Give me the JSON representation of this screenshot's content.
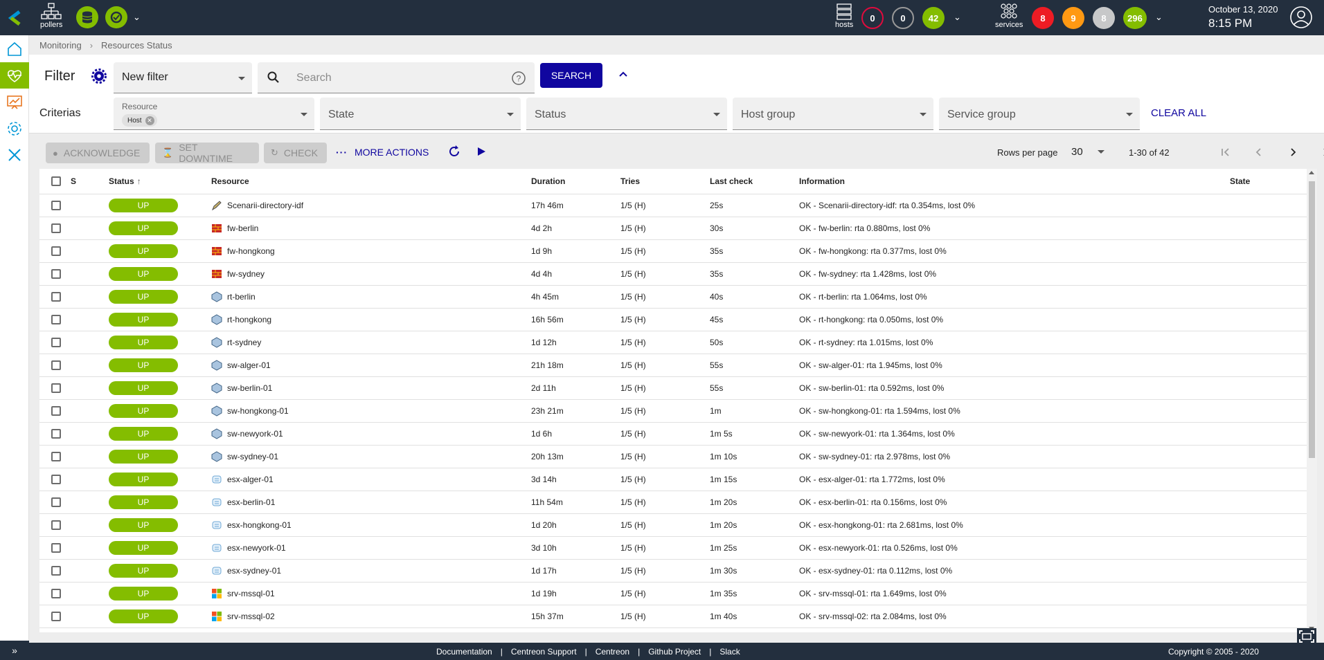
{
  "topbar": {
    "pollers_label": "pollers",
    "hosts_label": "hosts",
    "services_label": "services",
    "host_counts": {
      "down": "0",
      "unreachable": "0",
      "up": "42"
    },
    "service_counts": {
      "critical": "8",
      "warning": "9",
      "unknown": "8",
      "ok": "296"
    },
    "date": "October 13, 2020",
    "time": "8:15 PM"
  },
  "breadcrumb": {
    "parent": "Monitoring",
    "current": "Resources Status"
  },
  "filter": {
    "title": "Filter",
    "selected_filter": "New filter",
    "search_placeholder": "Search",
    "search_button": "SEARCH",
    "criterias_label": "Criterias",
    "resource_label": "Resource",
    "resource_chip": "Host",
    "state_label": "State",
    "status_label": "Status",
    "host_group_label": "Host group",
    "service_group_label": "Service group",
    "clear_all": "CLEAR ALL"
  },
  "actions": {
    "acknowledge": "ACKNOWLEDGE",
    "set_downtime": "SET DOWNTIME",
    "check": "CHECK",
    "more_actions": "MORE ACTIONS",
    "rows_per_page_label": "Rows per page",
    "rows_per_page_value": "30",
    "page_range": "1-30 of 42"
  },
  "table": {
    "columns": {
      "s": "S",
      "status": "Status",
      "resource": "Resource",
      "duration": "Duration",
      "tries": "Tries",
      "last_check": "Last check",
      "information": "Information",
      "state": "State"
    },
    "rows": [
      {
        "status": "UP",
        "icon": "pencil-icon",
        "resource": "Scenarii-directory-idf",
        "duration": "17h 46m",
        "tries": "1/5 (H)",
        "last_check": "25s",
        "information": "OK - Scenarii-directory-idf: rta 0.354ms, lost 0%"
      },
      {
        "status": "UP",
        "icon": "firewall-icon",
        "resource": "fw-berlin",
        "duration": "4d 2h",
        "tries": "1/5 (H)",
        "last_check": "30s",
        "information": "OK - fw-berlin: rta 0.880ms, lost 0%"
      },
      {
        "status": "UP",
        "icon": "firewall-icon",
        "resource": "fw-hongkong",
        "duration": "1d 9h",
        "tries": "1/5 (H)",
        "last_check": "35s",
        "information": "OK - fw-hongkong: rta 0.377ms, lost 0%"
      },
      {
        "status": "UP",
        "icon": "firewall-icon",
        "resource": "fw-sydney",
        "duration": "4d 4h",
        "tries": "1/5 (H)",
        "last_check": "35s",
        "information": "OK - fw-sydney: rta 1.428ms, lost 0%"
      },
      {
        "status": "UP",
        "icon": "router-icon",
        "resource": "rt-berlin",
        "duration": "4h 45m",
        "tries": "1/5 (H)",
        "last_check": "40s",
        "information": "OK - rt-berlin: rta 1.064ms, lost 0%"
      },
      {
        "status": "UP",
        "icon": "router-icon",
        "resource": "rt-hongkong",
        "duration": "16h 56m",
        "tries": "1/5 (H)",
        "last_check": "45s",
        "information": "OK - rt-hongkong: rta 0.050ms, lost 0%"
      },
      {
        "status": "UP",
        "icon": "router-icon",
        "resource": "rt-sydney",
        "duration": "1d 12h",
        "tries": "1/5 (H)",
        "last_check": "50s",
        "information": "OK - rt-sydney: rta 1.015ms, lost 0%"
      },
      {
        "status": "UP",
        "icon": "switch-icon",
        "resource": "sw-alger-01",
        "duration": "21h 18m",
        "tries": "1/5 (H)",
        "last_check": "55s",
        "information": "OK - sw-alger-01: rta 1.945ms, lost 0%"
      },
      {
        "status": "UP",
        "icon": "switch-icon",
        "resource": "sw-berlin-01",
        "duration": "2d 11h",
        "tries": "1/5 (H)",
        "last_check": "55s",
        "information": "OK - sw-berlin-01: rta 0.592ms, lost 0%"
      },
      {
        "status": "UP",
        "icon": "switch-icon",
        "resource": "sw-hongkong-01",
        "duration": "23h 21m",
        "tries": "1/5 (H)",
        "last_check": "1m",
        "information": "OK - sw-hongkong-01: rta 1.594ms, lost 0%"
      },
      {
        "status": "UP",
        "icon": "switch-icon",
        "resource": "sw-newyork-01",
        "duration": "1d 6h",
        "tries": "1/5 (H)",
        "last_check": "1m 5s",
        "information": "OK - sw-newyork-01: rta 1.364ms, lost 0%"
      },
      {
        "status": "UP",
        "icon": "switch-icon",
        "resource": "sw-sydney-01",
        "duration": "20h 13m",
        "tries": "1/5 (H)",
        "last_check": "1m 10s",
        "information": "OK - sw-sydney-01: rta 2.978ms, lost 0%"
      },
      {
        "status": "UP",
        "icon": "esx-icon",
        "resource": "esx-alger-01",
        "duration": "3d 14h",
        "tries": "1/5 (H)",
        "last_check": "1m 15s",
        "information": "OK - esx-alger-01: rta 1.772ms, lost 0%"
      },
      {
        "status": "UP",
        "icon": "esx-icon",
        "resource": "esx-berlin-01",
        "duration": "11h 54m",
        "tries": "1/5 (H)",
        "last_check": "1m 20s",
        "information": "OK - esx-berlin-01: rta 0.156ms, lost 0%"
      },
      {
        "status": "UP",
        "icon": "esx-icon",
        "resource": "esx-hongkong-01",
        "duration": "1d 20h",
        "tries": "1/5 (H)",
        "last_check": "1m 20s",
        "information": "OK - esx-hongkong-01: rta 2.681ms, lost 0%"
      },
      {
        "status": "UP",
        "icon": "esx-icon",
        "resource": "esx-newyork-01",
        "duration": "3d 10h",
        "tries": "1/5 (H)",
        "last_check": "1m 25s",
        "information": "OK - esx-newyork-01: rta 0.526ms, lost 0%"
      },
      {
        "status": "UP",
        "icon": "esx-icon",
        "resource": "esx-sydney-01",
        "duration": "1d 17h",
        "tries": "1/5 (H)",
        "last_check": "1m 30s",
        "information": "OK - esx-sydney-01: rta 0.112ms, lost 0%"
      },
      {
        "status": "UP",
        "icon": "windows-icon",
        "resource": "srv-mssql-01",
        "duration": "1d 19h",
        "tries": "1/5 (H)",
        "last_check": "1m 35s",
        "information": "OK - srv-mssql-01: rta 1.649ms, lost 0%"
      },
      {
        "status": "UP",
        "icon": "windows-icon",
        "resource": "srv-mssql-02",
        "duration": "15h 37m",
        "tries": "1/5 (H)",
        "last_check": "1m 40s",
        "information": "OK - srv-mssql-02: rta 2.084ms, lost 0%"
      }
    ]
  },
  "footer": {
    "links": [
      "Documentation",
      "Centreon Support",
      "Centreon",
      "Github Project",
      "Slack"
    ],
    "copyright": "Copyright © 2005 - 2020"
  },
  "colors": {
    "topbar": "#232f3e",
    "up_green": "#84bd00",
    "primary": "#10069f",
    "critical": "#ed1c24",
    "warning": "#ff9913",
    "unknown": "#c7c8c9"
  }
}
